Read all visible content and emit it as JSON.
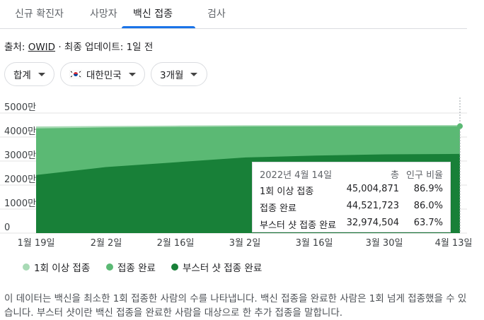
{
  "tabs": [
    {
      "label": "신규 확진자",
      "active": false
    },
    {
      "label": "사망자",
      "active": false
    },
    {
      "label": "백신 접종",
      "active": true
    },
    {
      "label": "검사",
      "active": false
    }
  ],
  "source": {
    "prefix": "출처:",
    "name": "OWID",
    "updated": "· 최종 업데이트: 1일 전"
  },
  "filters": {
    "metric": "합계",
    "country": "대한민국",
    "period": "3개월",
    "flag_icon": "korea-flag-icon"
  },
  "colors": {
    "first_dose": "#a8dab5",
    "fully_vaccinated": "#5bb974",
    "booster": "#188038",
    "tab_accent": "#1a73e8"
  },
  "chart_data": {
    "type": "area",
    "y_ticks": [
      "5000만",
      "4000만",
      "3000만",
      "2000만",
      "1000만",
      "0"
    ],
    "y_max": 50000000,
    "x_ticks": [
      "1월 19일",
      "2월 2일",
      "2월 16일",
      "3월 2일",
      "3월 16일",
      "3월 30일",
      "4월 13일"
    ],
    "x": [
      "2022-01-19",
      "2022-02-02",
      "2022-02-16",
      "2022-03-02",
      "2022-03-16",
      "2022-03-30",
      "2022-04-14"
    ],
    "series": [
      {
        "name": "1회 이상 접종",
        "values": [
          44400000,
          44600000,
          44800000,
          44900000,
          44950000,
          44980000,
          45004871
        ]
      },
      {
        "name": "접종 완료",
        "values": [
          43600000,
          44000000,
          44250000,
          44400000,
          44480000,
          44510000,
          44521723
        ]
      },
      {
        "name": "부스터 샷 접종 완료",
        "values": [
          24200000,
          27500000,
          29500000,
          31500000,
          32300000,
          32800000,
          32974504
        ]
      }
    ],
    "legend_position": "bottom-left",
    "grid": true
  },
  "tooltip": {
    "date": "2022년 4월 14일",
    "col_total": "총",
    "col_pct": "인구 비율",
    "rows": [
      {
        "label": "1회 이상 접종",
        "total": "45,004,871",
        "pct": "86.9%"
      },
      {
        "label": "접종 완료",
        "total": "44,521,723",
        "pct": "86.0%"
      },
      {
        "label": "부스터 샷 접종 완료",
        "total": "32,974,504",
        "pct": "63.7%"
      }
    ]
  },
  "legend": [
    {
      "label": "1회 이상 접종"
    },
    {
      "label": "접종 완료"
    },
    {
      "label": "부스터 샷 접종 완료"
    }
  ],
  "note": "이 데이터는 백신을 최소한 1회 접종한 사람의 수를 나타냅니다. 백신 접종을 완료한 사람은 1회 넘게 접종했을 수 있습니다. 부스터 샷이란 백신 접종을 완료한 사람을 대상으로 한 추가 접종을 말합니다."
}
